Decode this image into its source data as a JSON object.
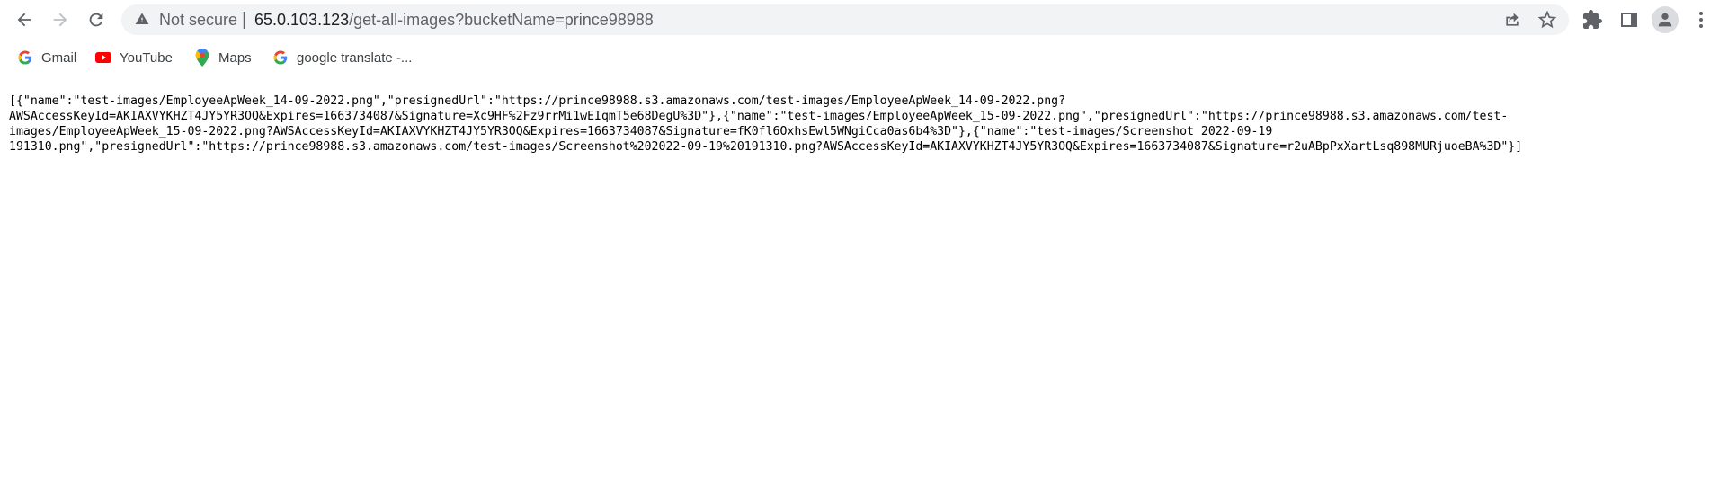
{
  "browser": {
    "security_label": "Not secure",
    "separator": "|",
    "url_host": "65.0.103.123",
    "url_path": "/get-all-images?bucketName=prince98988",
    "icons": [
      "back-arrow-icon",
      "forward-arrow-icon",
      "reload-icon",
      "warning-icon",
      "share-icon",
      "star-icon",
      "extensions-icon",
      "side-panel-icon",
      "profile-icon",
      "more-menu-icon"
    ]
  },
  "bookmarks": [
    {
      "label": "Gmail",
      "icon": "google-icon"
    },
    {
      "label": "YouTube",
      "icon": "youtube-icon"
    },
    {
      "label": "Maps",
      "icon": "maps-pin-icon"
    },
    {
      "label": "google translate -...",
      "icon": "google-icon"
    }
  ],
  "page": {
    "lines": [
      "[{\"name\":\"test-images/EmployeeApWeek_14-09-2022.png\",\"presignedUrl\":\"https://prince98988.s3.amazonaws.com/test-images/EmployeeApWeek_14-09-2022.png?",
      "AWSAccessKeyId=AKIAXVYKHZT4JY5YR3OQ&Expires=1663734087&Signature=Xc9HF%2Fz9rrMi1wEIqmT5e68DegU%3D\"},{\"name\":\"test-images/EmployeeApWeek_15-09-2022.png\",\"presignedUrl\":\"https://prince98988.s3.amazonaws.com/test-",
      "images/EmployeeApWeek_15-09-2022.png?AWSAccessKeyId=AKIAXVYKHZT4JY5YR3OQ&Expires=1663734087&Signature=fK0fl6OxhsEwl5WNgiCca0as6b4%3D\"},{\"name\":\"test-images/Screenshot 2022-09-19",
      "191310.png\",\"presignedUrl\":\"https://prince98988.s3.amazonaws.com/test-images/Screenshot%202022-09-19%20191310.png?AWSAccessKeyId=AKIAXVYKHZT4JY5YR3OQ&Expires=1663734087&Signature=r2uABpPxXartLsq898MURjuoeBA%3D\"}]"
    ]
  },
  "colors": {
    "omnibox_bg": "#f1f3f4",
    "icon_gray": "#5f6368",
    "youtube_red": "#ff0000"
  }
}
